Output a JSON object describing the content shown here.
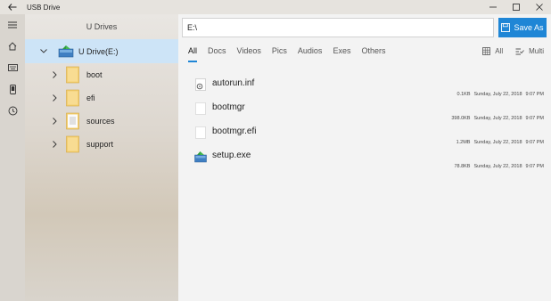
{
  "window": {
    "title": "USB Drive"
  },
  "rail": {
    "items": [
      "menu-icon",
      "home-icon",
      "keyboard-icon",
      "phone-icon",
      "history-icon"
    ]
  },
  "sidebar": {
    "header": "U Drives",
    "root": {
      "label": "U Drive(E:)"
    },
    "folders": [
      {
        "label": "boot"
      },
      {
        "label": "efi"
      },
      {
        "label": "sources"
      },
      {
        "label": "support"
      }
    ]
  },
  "main": {
    "path": "E:\\",
    "save_label": "Save As",
    "tabs": [
      "All",
      "Docs",
      "Videos",
      "Pics",
      "Audios",
      "Exes",
      "Others"
    ],
    "active_tab": "All",
    "views": {
      "all_label": "All",
      "multi_label": "Multi"
    },
    "files": [
      {
        "name": "autorun.inf",
        "size": "0.1KB",
        "date": "Sunday, July 22, 2018",
        "time": "9:07 PM",
        "icon": "settings-file-icon"
      },
      {
        "name": "bootmgr",
        "size": "398.0KB",
        "date": "Sunday, July 22, 2018",
        "time": "9:07 PM",
        "icon": "blank-file-icon"
      },
      {
        "name": "bootmgr.efi",
        "size": "1.2MB",
        "date": "Sunday, July 22, 2018",
        "time": "9:07 PM",
        "icon": "blank-file-icon"
      },
      {
        "name": "setup.exe",
        "size": "78.8KB",
        "date": "Sunday, July 22, 2018",
        "time": "9:07 PM",
        "icon": "setup-exe-icon"
      }
    ]
  },
  "colors": {
    "accent": "#1f86d6",
    "selection": "#cde4f7",
    "folder": "#f3cf73"
  }
}
